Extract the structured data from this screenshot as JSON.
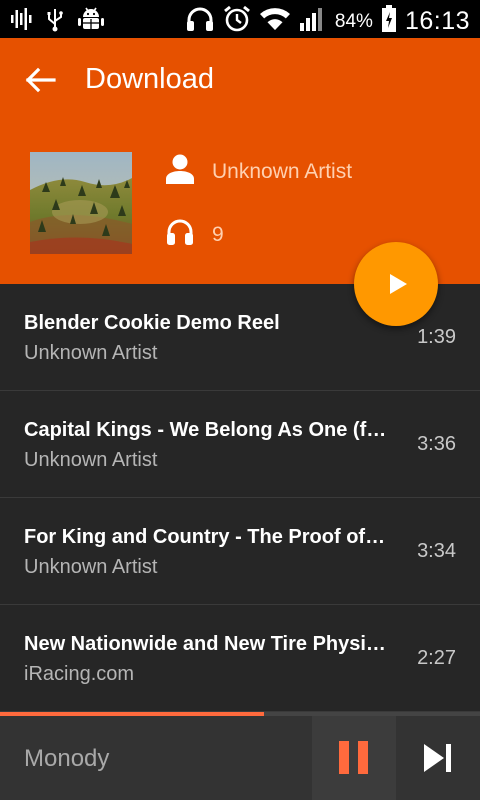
{
  "status_bar": {
    "battery_percent": "84%",
    "time": "16:13",
    "left_icons": [
      "signal-bars-icon",
      "usb-icon",
      "android-debug-icon"
    ],
    "right_icons": [
      "headphones-icon",
      "alarm-icon",
      "wifi-icon",
      "cell-signal-icon",
      "battery-charging-icon"
    ]
  },
  "header": {
    "title": "Download",
    "background_color": "#e65100",
    "artist": "Unknown Artist",
    "play_count": "9"
  },
  "fab": {
    "icon": "play-icon",
    "color": "#ff9800"
  },
  "tracks": [
    {
      "title": "Blender Cookie Demo Reel",
      "artist": "Unknown Artist",
      "duration": "1:39"
    },
    {
      "title": "Capital Kings - We Belong As One (fe…",
      "artist": "Unknown Artist",
      "duration": "3:36"
    },
    {
      "title": "For King and Country - The Proof of…",
      "artist": "Unknown Artist",
      "duration": "3:34"
    },
    {
      "title": "New Nationwide and New Tire Physi…",
      "artist": "iRacing.com",
      "duration": "2:27"
    }
  ],
  "player": {
    "label": "Monody",
    "progress_fraction": 0.55,
    "accent_color": "#ff6a3d"
  }
}
